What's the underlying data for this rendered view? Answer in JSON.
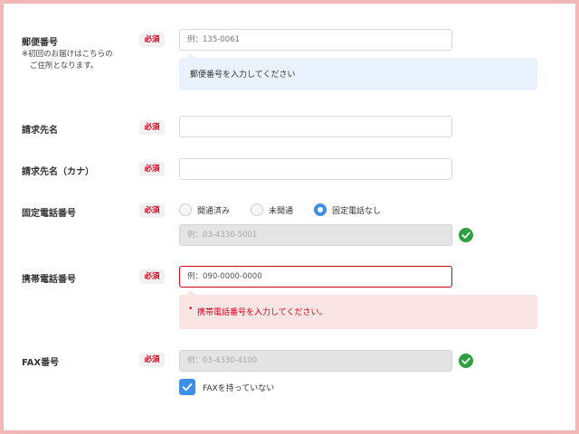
{
  "form": {
    "required_label": "必須",
    "postal": {
      "label": "郵便番号",
      "note_line1": "※初回のお届けはこちらの",
      "note_line2": "ご住所となります。",
      "placeholder": "例：135-0061",
      "hint": "郵便番号を入力してください"
    },
    "billing_name": {
      "label": "請求先名",
      "value": ""
    },
    "billing_kana": {
      "label": "請求先名（カナ）",
      "value": ""
    },
    "landline": {
      "label": "固定電話番号",
      "options": [
        "開通済み",
        "未開通",
        "固定電話なし"
      ],
      "selected": "固定電話なし",
      "placeholder": "例：03-4330-5001",
      "valid_icon": "check-circle-icon"
    },
    "mobile": {
      "label": "携帯電話番号",
      "placeholder": "例：090-0000-0000",
      "error_bullet": "•",
      "error": "携帯電話番号を入力してください。"
    },
    "fax": {
      "label": "FAX番号",
      "placeholder": "例：03-4330-4100",
      "valid_icon": "check-circle-icon",
      "no_fax_label": "FAXを持っていない",
      "no_fax_checked": true
    }
  },
  "colors": {
    "border_frame": "#f2b8b8",
    "accent": "#3d8fe8",
    "error": "#d0021b",
    "valid": "#2e9e3e",
    "info_bg": "#eaf3fd",
    "error_bg": "#fbe4e4"
  }
}
